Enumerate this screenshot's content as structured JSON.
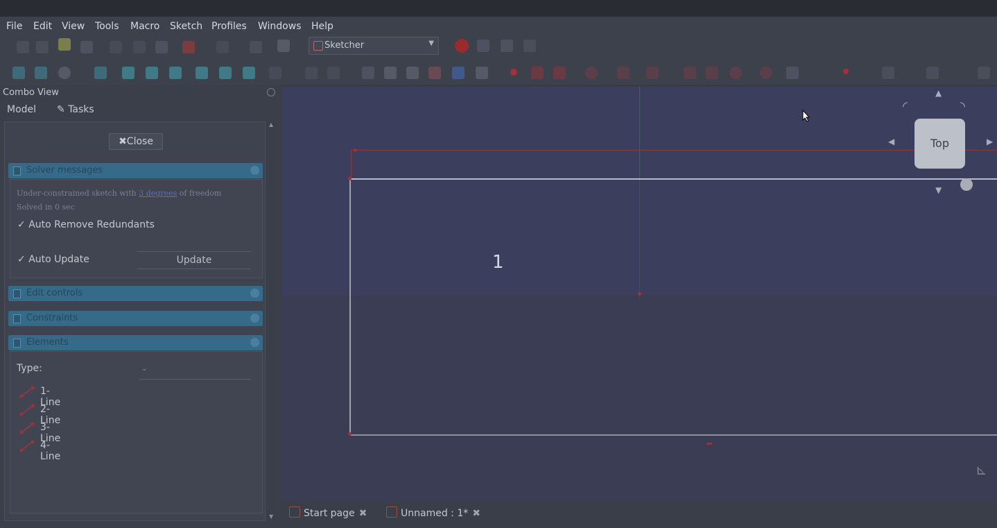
{
  "menu": [
    "File",
    "Edit",
    "View",
    "Tools",
    "Macro",
    "Sketch",
    "Profiles",
    "Windows",
    "Help"
  ],
  "workbench": "Sketcher",
  "combo_view": {
    "title": "Combo View",
    "tabs": [
      "Model",
      "Tasks"
    ],
    "close_label": "Close",
    "solver": {
      "header": "Solver messages",
      "message_prefix": "Under-constrained sketch with",
      "message_link": "3 degrees",
      "message_suffix": "of freedom",
      "solved_text": "Solved in 0 sec",
      "auto_remove_label": "Auto Remove Redundants",
      "auto_update_label": "Auto Update",
      "update_button": "Update"
    },
    "sections": [
      "Edit controls",
      "Constraints",
      "Elements"
    ],
    "elements": {
      "type_label": "Type:",
      "items": [
        "1-Line",
        "2-Line",
        "3-Line",
        "4-Line"
      ]
    }
  },
  "viewport": {
    "label": "1",
    "navcube_face": "Top"
  },
  "doc_tabs": [
    {
      "label": "Start page"
    },
    {
      "label": "Unnamed : 1*"
    }
  ],
  "colors": {
    "section_header": "#356a89",
    "constraint_red": "#a0303a",
    "viewport_bg": "#3b3f5d"
  }
}
